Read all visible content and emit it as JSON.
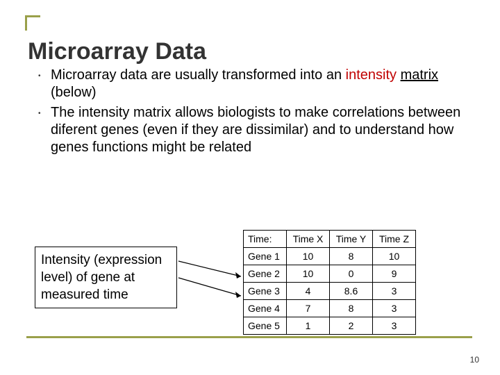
{
  "title": "Microarray Data",
  "bullets": [
    {
      "pre": "Microarray data are usually transformed into an ",
      "intensity": "intensity",
      "matrix": "matrix",
      "post": " (below)"
    },
    {
      "text": "The intensity matrix allows biologists to make correlations between diferent genes (even if they are dissimilar) and to understand how genes functions might be related"
    }
  ],
  "callout": "Intensity (expression level) of gene at measured time",
  "chart_data": {
    "type": "table",
    "title": "Gene intensity matrix by time",
    "columns": [
      "Time:",
      "Time X",
      "Time Y",
      "Time Z"
    ],
    "rows": [
      {
        "label": "Gene 1",
        "values": [
          10,
          8,
          10
        ]
      },
      {
        "label": "Gene 2",
        "values": [
          10,
          0,
          9
        ]
      },
      {
        "label": "Gene 3",
        "values": [
          4,
          8.6,
          3
        ]
      },
      {
        "label": "Gene 4",
        "values": [
          7,
          8,
          3
        ]
      },
      {
        "label": "Gene 5",
        "values": [
          1,
          2,
          3
        ]
      }
    ]
  },
  "page_number": "10"
}
